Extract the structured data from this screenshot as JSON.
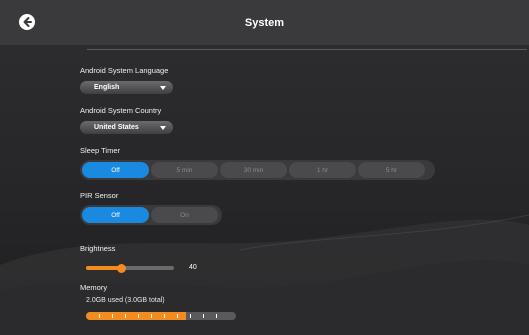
{
  "header": {
    "title": "System",
    "back_icon": "back-arrow-icon"
  },
  "language": {
    "label": "Android System Language",
    "value": "English"
  },
  "country": {
    "label": "Android System Country",
    "value": "United States"
  },
  "sleep_timer": {
    "label": "Sleep Timer",
    "options": [
      "Off",
      "5 min",
      "30 min",
      "1 hr",
      "5 hr"
    ],
    "selected": "Off"
  },
  "pir_sensor": {
    "label": "PIR Sensor",
    "options": [
      "Off",
      "On"
    ],
    "selected": "Off"
  },
  "brightness": {
    "label": "Brightness",
    "value": "40",
    "fraction": 0.4
  },
  "memory": {
    "label": "Memory",
    "usage_text": "2.0GB used (3.0GB total)",
    "used_fraction": 0.667
  },
  "colors": {
    "accent_blue": "#1a8ae0",
    "accent_orange": "#f28c1e",
    "background": "#2a2a2c"
  }
}
